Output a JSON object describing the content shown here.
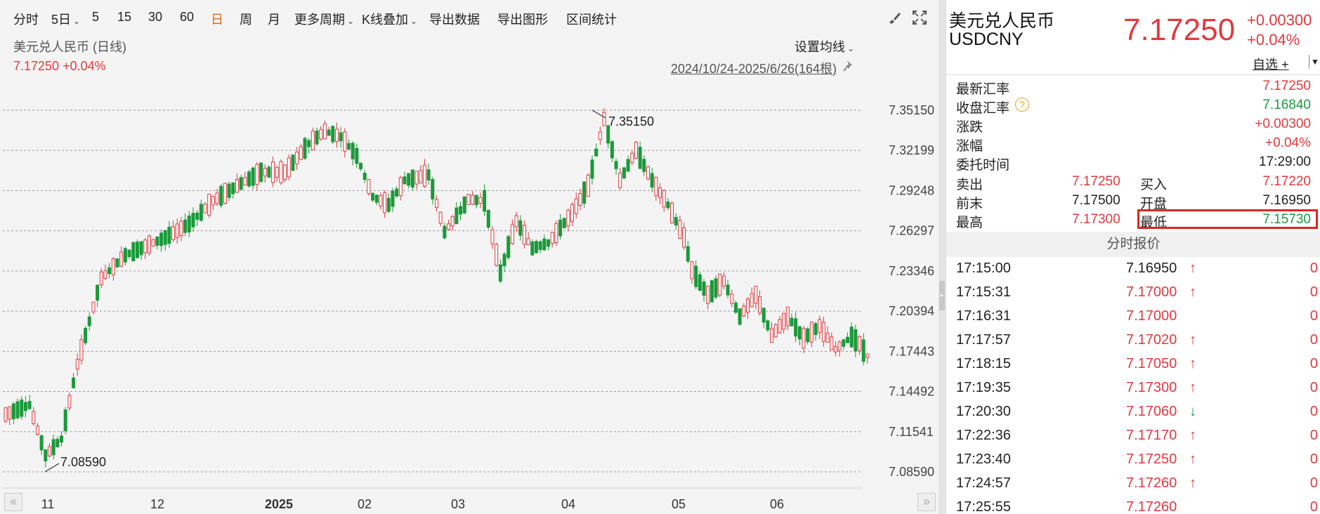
{
  "toolbar": {
    "items": [
      {
        "label": "分时",
        "caret": false,
        "active": false
      },
      {
        "label": "5日",
        "caret": true,
        "active": false
      },
      {
        "label": "5",
        "caret": false,
        "active": false
      },
      {
        "label": "15",
        "caret": false,
        "active": false
      },
      {
        "label": "30",
        "caret": false,
        "active": false
      },
      {
        "label": "60",
        "caret": false,
        "active": false
      },
      {
        "label": "日",
        "caret": false,
        "active": true
      },
      {
        "label": "周",
        "caret": false,
        "active": false
      },
      {
        "label": "月",
        "caret": false,
        "active": false
      },
      {
        "label": "更多周期",
        "caret": true,
        "active": false
      },
      {
        "label": "K线叠加",
        "caret": true,
        "active": false
      },
      {
        "label": "导出数据",
        "caret": false,
        "active": false
      },
      {
        "label": "导出图形",
        "caret": false,
        "active": false
      },
      {
        "label": "区间统计",
        "caret": false,
        "active": false
      }
    ],
    "right_icons": [
      "brush-icon",
      "expand-icon"
    ]
  },
  "chart_header": {
    "title": "美元兑人民币 (日线)",
    "price_line": "7.17250 +0.04%",
    "ma_setting": "设置均线",
    "date_range": "2024/10/24-2025/6/26(164根)"
  },
  "chart_data": {
    "type": "candlestick",
    "y_ticks": [
      "7.35150",
      "7.32199",
      "7.29248",
      "7.26297",
      "7.23346",
      "7.20394",
      "7.17443",
      "7.14492",
      "7.11541",
      "7.08590"
    ],
    "ylim": [
      7.0859,
      7.3515
    ],
    "x_ticks": [
      "11",
      "12",
      "2025",
      "02",
      "03",
      "04",
      "05",
      "06"
    ],
    "annotations": [
      {
        "label": "7.35150",
        "type": "high"
      },
      {
        "label": "7.08590",
        "type": "low"
      }
    ],
    "last_close": 7.1725,
    "up_color": "#e0393e",
    "down_color": "#1a9a3a"
  },
  "quote": {
    "name": "美元兑人民币",
    "code": "USDCNY",
    "price": "7.17250",
    "change": "+0.00300",
    "change_pct": "+0.04%",
    "watchlist_label": "自选 +",
    "rows": [
      {
        "label": "最新汇率",
        "value": "7.17250",
        "color": "red"
      },
      {
        "label": "收盘汇率",
        "value": "7.16840",
        "color": "green",
        "help": true
      },
      {
        "label": "涨跌",
        "value": "+0.00300",
        "color": "red"
      },
      {
        "label": "涨幅",
        "value": "+0.04%",
        "color": "red"
      },
      {
        "label": "委托时间",
        "value": "17:29:00",
        "color": "dark"
      }
    ],
    "grid": [
      {
        "l1": "卖出",
        "v1": "7.17250",
        "c1": "red",
        "l2": "买入",
        "v2": "7.17220",
        "c2": "red"
      },
      {
        "l1": "前末",
        "v1": "7.17500",
        "c1": "dark",
        "l2": "开盘",
        "v2": "7.16950",
        "c2": "dark"
      },
      {
        "l1": "最高",
        "v1": "7.17300",
        "c1": "red",
        "l2": "最低",
        "v2": "7.15730",
        "c2": "green"
      }
    ],
    "tick_header": "分时报价",
    "ticks": [
      {
        "time": "17:15:00",
        "price": "7.16950",
        "price_color": "dark",
        "dir": "up",
        "vol": "0"
      },
      {
        "time": "17:15:31",
        "price": "7.17000",
        "price_color": "red",
        "dir": "up",
        "vol": "0"
      },
      {
        "time": "17:16:31",
        "price": "7.17000",
        "price_color": "red",
        "dir": "",
        "vol": "0"
      },
      {
        "time": "17:17:57",
        "price": "7.17020",
        "price_color": "red",
        "dir": "up",
        "vol": "0"
      },
      {
        "time": "17:18:15",
        "price": "7.17050",
        "price_color": "red",
        "dir": "up",
        "vol": "0"
      },
      {
        "time": "17:19:35",
        "price": "7.17300",
        "price_color": "red",
        "dir": "up",
        "vol": "0"
      },
      {
        "time": "17:20:30",
        "price": "7.17060",
        "price_color": "red",
        "dir": "down",
        "vol": "0"
      },
      {
        "time": "17:22:36",
        "price": "7.17170",
        "price_color": "red",
        "dir": "up",
        "vol": "0"
      },
      {
        "time": "17:23:40",
        "price": "7.17250",
        "price_color": "red",
        "dir": "up",
        "vol": "0"
      },
      {
        "time": "17:24:57",
        "price": "7.17260",
        "price_color": "red",
        "dir": "up",
        "vol": "0"
      },
      {
        "time": "17:25:55",
        "price": "7.17260",
        "price_color": "red",
        "dir": "",
        "vol": "0"
      }
    ]
  }
}
